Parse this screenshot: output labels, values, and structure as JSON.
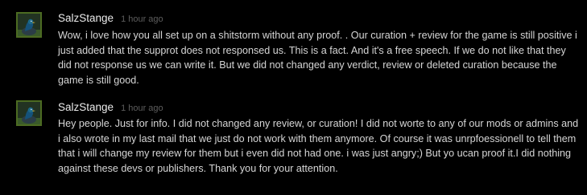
{
  "comments": [
    {
      "author": "SalzStange",
      "timestamp": "1 hour ago",
      "avatar_icon": "duck-avatar-icon",
      "text": "Wow, i love how you all set up on a shitstorm without any proof. . Our curation + review for the game is still positive i just added that the supprot does not responsed us. This is a fact. And it's a free speech. If we do not like that they did not response us we can write it. But we did not changed any verdict, review or deleted curation because the game is still good."
    },
    {
      "author": "SalzStange",
      "timestamp": "1 hour ago",
      "avatar_icon": "duck-avatar-icon",
      "text": "Hey people. Just for info. I did not changed any review, or curation! I did not worte to any of our mods or admins and i also wrote in my last mail that we just do not work with them anymore. Of course it was unrpfoessionell to tell them that i will change my review for them but i even did not had one. i was just angry;) But yo ucan proof it.I did nothing against these devs or publishers. Thank you for your attention."
    }
  ],
  "colors": {
    "background": "#000000",
    "author": "#ebebeb",
    "timestamp": "#5e5e5e",
    "text": "#d6d6d6",
    "avatar_border": "#4c6b22"
  }
}
